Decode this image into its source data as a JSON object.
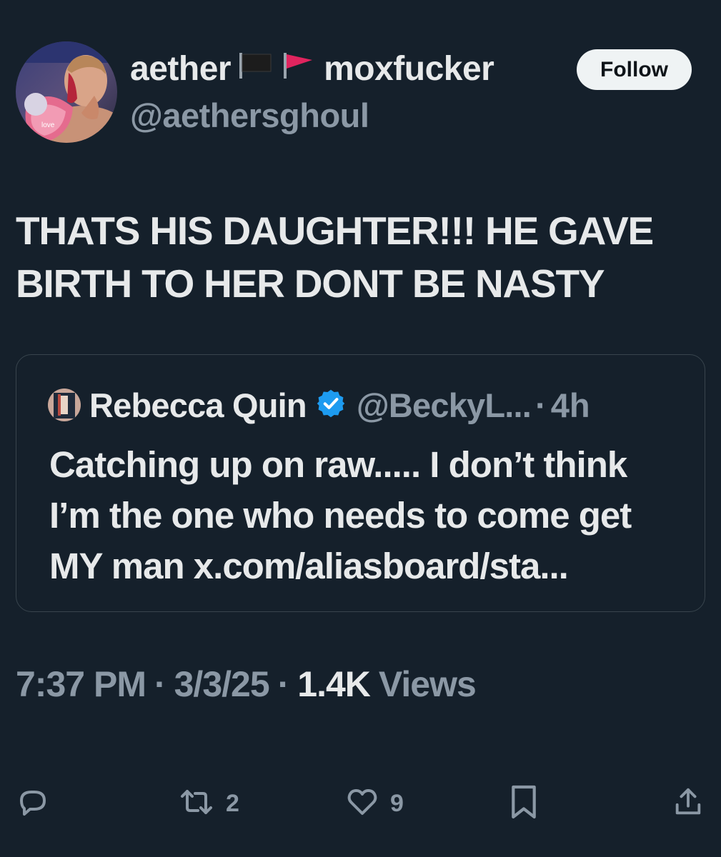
{
  "header": {
    "display_name_part1": "aether",
    "display_name_part2": "moxfucker",
    "handle": "@aethersghoul",
    "follow_label": "Follow"
  },
  "tweet": {
    "text": "THATS HIS DAUGHTER!!! HE GAVE BIRTH TO HER DONT BE NASTY"
  },
  "quote": {
    "name": "Rebecca Quin",
    "handle": "@BeckyL...",
    "separator": "·",
    "time": "4h",
    "text": "Catching up on raw..... I don’t think I’m the one who needs to come get MY man x.com/aliasboard/sta..."
  },
  "meta": {
    "time": "7:37 PM",
    "separator": "·",
    "date": "3/3/25",
    "views_count": "1.4K",
    "views_label": "Views"
  },
  "actions": {
    "reply_icon": "reply-icon",
    "retweet_icon": "retweet-icon",
    "retweet_count": "2",
    "like_icon": "heart-icon",
    "like_count": "9",
    "bookmark_icon": "bookmark-icon",
    "share_icon": "share-icon"
  },
  "colors": {
    "background": "#15202b",
    "text_primary": "#e7e9ea",
    "text_secondary": "#8b98a5",
    "border": "#38444d",
    "follow_bg": "#eff3f4",
    "verified_blue": "#1d9bf0",
    "red_flag": "#e0245e"
  }
}
